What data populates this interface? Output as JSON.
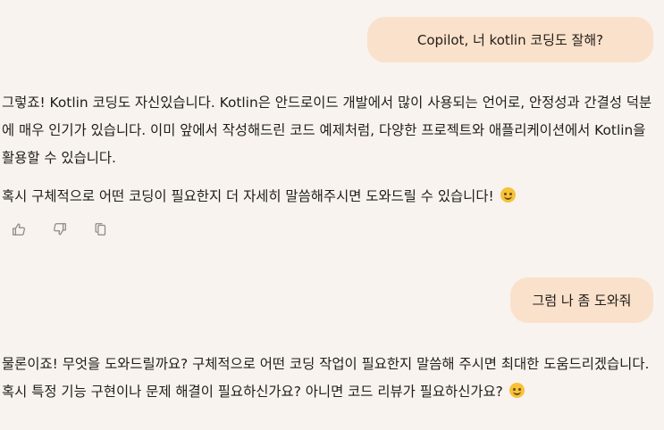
{
  "messages": [
    {
      "role": "user",
      "text": "Copilot, 너 kotlin 코딩도 잘해?"
    },
    {
      "role": "assistant",
      "paragraph_1": "그렇죠! Kotlin 코딩도 자신있습니다. Kotlin은 안드로이드 개발에서 많이 사용되는 언어로, 안정성과 간결성 덕분에 매우 인기가 있습니다. 이미 앞에서 작성해드린 코드 예제처럼, 다양한 프로젝트와 애플리케이션에서 Kotlin을 활용할 수 있습니다.",
      "paragraph_2": "혹시 구체적으로 어떤 코딩이 필요한지 더 자세히 말씀해주시면 도와드릴 수 있습니다!",
      "emoji": "smiling-face-icon"
    },
    {
      "role": "user",
      "text": "그럼 나 좀 도와줘"
    },
    {
      "role": "assistant",
      "paragraph_1": "물론이죠! 무엇을 도와드릴까요? 구체적으로 어떤 코딩 작업이 필요한지 말씀해 주시면 최대한 도움드리겠습니다. 혹시 특정 기능 구현이나 문제 해결이 필요하신가요? 아니면 코드 리뷰가 필요하신가요?",
      "emoji": "smiling-face-icon"
    }
  ],
  "actions": {
    "like_icon": "thumbs-up-icon",
    "dislike_icon": "thumbs-down-icon",
    "copy_icon": "copy-icon"
  },
  "colors": {
    "background": "#f8f3ee",
    "user_bubble": "#fae1cb",
    "text": "#1f1d1a",
    "icon": "#8e8983"
  }
}
